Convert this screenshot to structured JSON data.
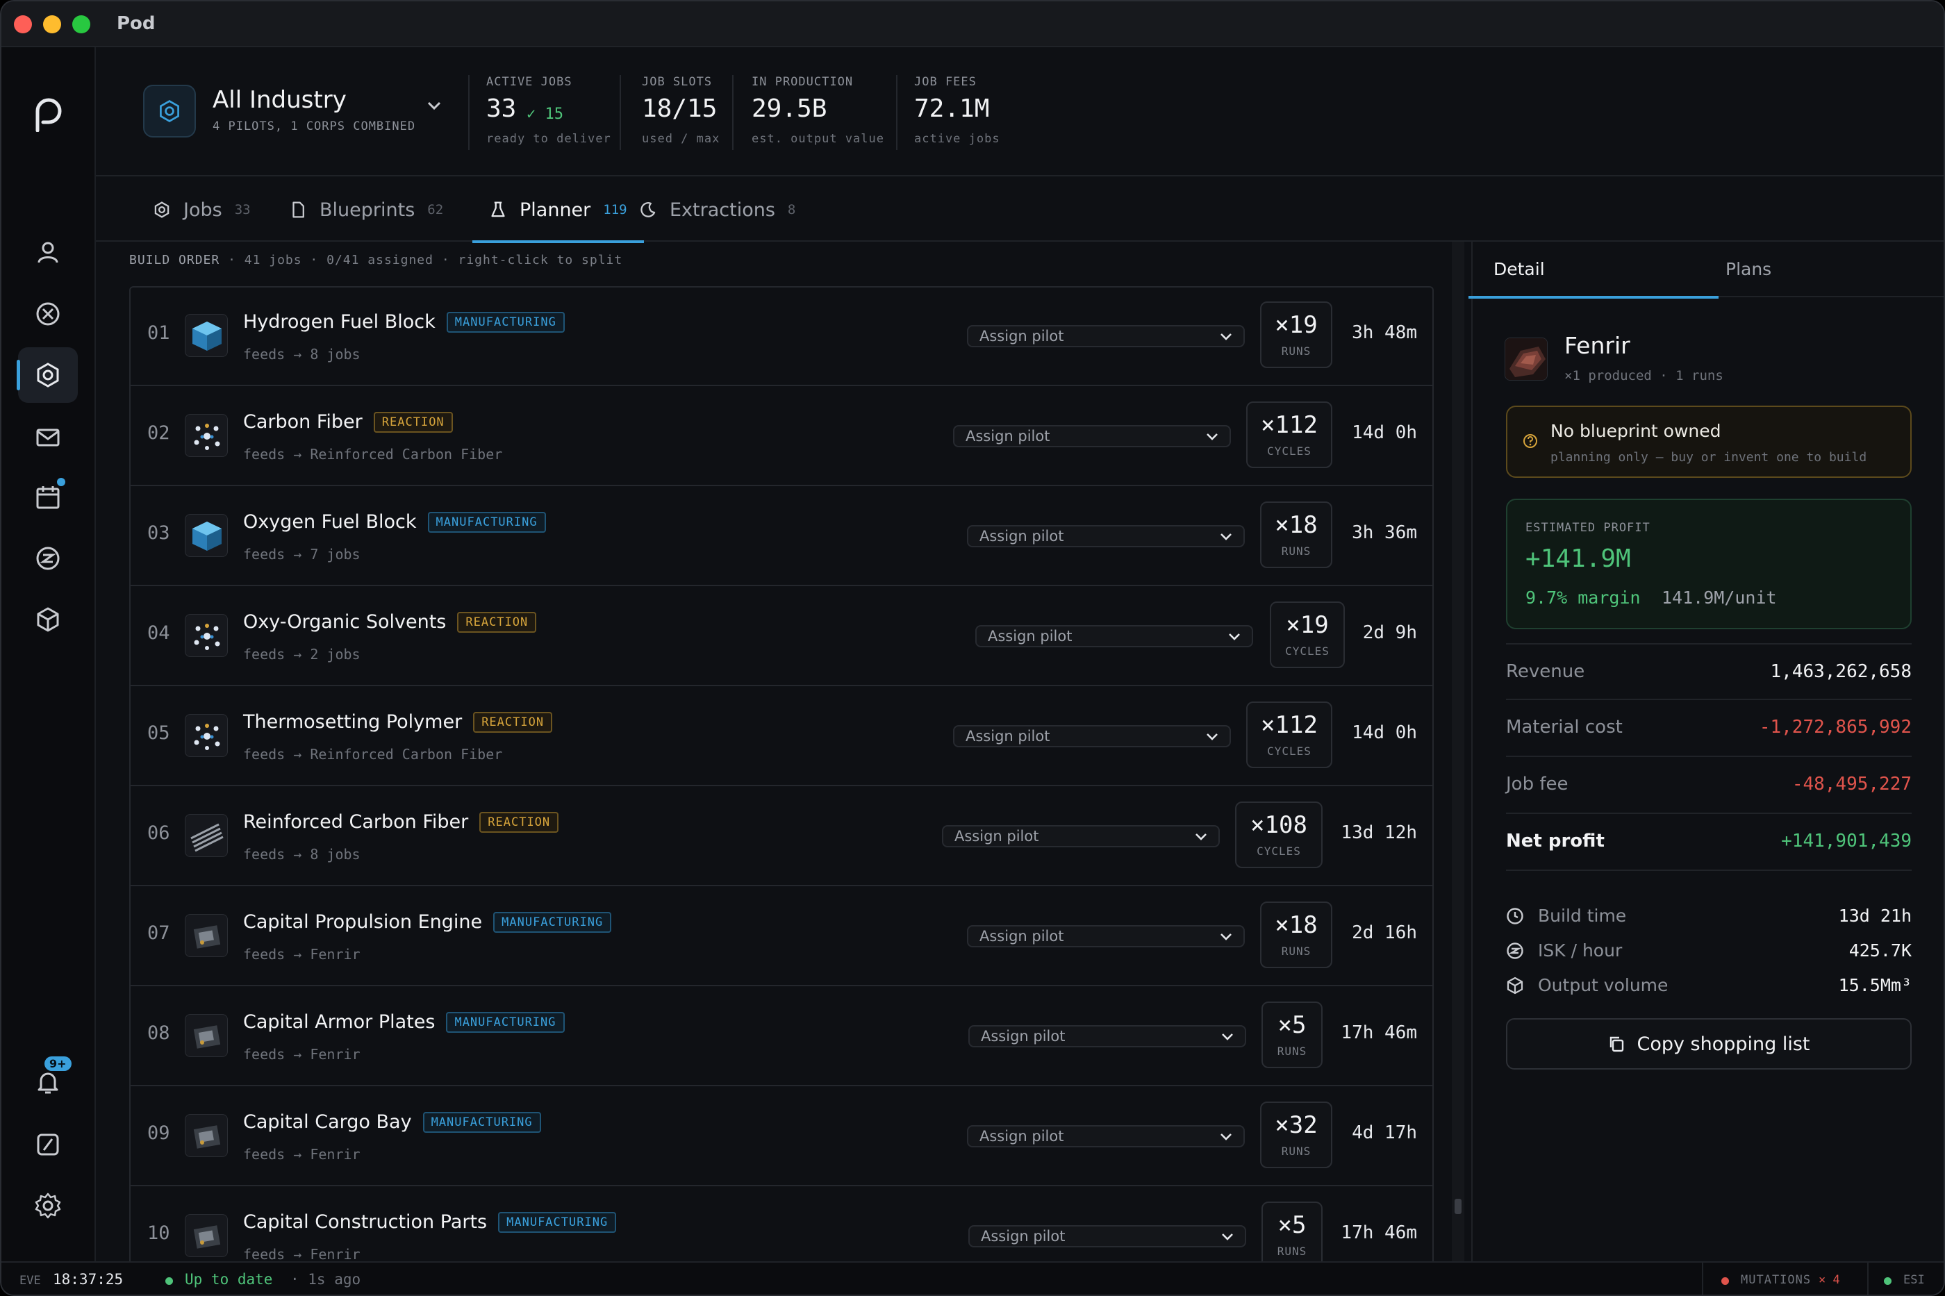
{
  "app": {
    "title": "Pod"
  },
  "header": {
    "org_name": "All Industry",
    "org_sub": "4 PILOTS, 1 CORPS COMBINED",
    "stats": [
      {
        "label": "ACTIVE JOBS",
        "value": "33",
        "extra": "✓ 15",
        "sub": "ready to deliver"
      },
      {
        "label": "JOB SLOTS",
        "value": "18/15",
        "sub": "used / max"
      },
      {
        "label": "IN PRODUCTION",
        "value": "29.5B",
        "sub": "est. output value"
      },
      {
        "label": "JOB FEES",
        "value": "72.1M",
        "sub": "active jobs"
      }
    ]
  },
  "rail": {
    "notif_badge": "9+"
  },
  "tabs": [
    {
      "label": "Jobs",
      "count": "33",
      "icon": "gear-icon"
    },
    {
      "label": "Blueprints",
      "count": "62",
      "icon": "document-icon"
    },
    {
      "label": "Planner",
      "count": "119",
      "icon": "flask-icon"
    },
    {
      "label": "Extractions",
      "count": "8",
      "icon": "moon-icon"
    }
  ],
  "build_order": {
    "title": "BUILD ORDER",
    "meta": "· 41 jobs · 0/41 assigned · right-click to split",
    "assign_placeholder": "Assign pilot",
    "rows": [
      {
        "num": "01",
        "name": "Hydrogen Fuel Block",
        "tag": "MANUFACTURING",
        "feeds": "feeds → 8 jobs",
        "runs": "×19",
        "unit": "RUNS",
        "time": "3h 48m",
        "icon": "fuel-block-icon"
      },
      {
        "num": "02",
        "name": "Carbon Fiber",
        "tag": "REACTION",
        "feeds": "feeds → Reinforced Carbon Fiber",
        "runs": "×112",
        "unit": "CYCLES",
        "time": "14d 0h",
        "icon": "molecule-icon"
      },
      {
        "num": "03",
        "name": "Oxygen Fuel Block",
        "tag": "MANUFACTURING",
        "feeds": "feeds → 7 jobs",
        "runs": "×18",
        "unit": "RUNS",
        "time": "3h 36m",
        "icon": "fuel-block-icon"
      },
      {
        "num": "04",
        "name": "Oxy-Organic Solvents",
        "tag": "REACTION",
        "feeds": "feeds → 2 jobs",
        "runs": "×19",
        "unit": "CYCLES",
        "time": "2d 9h",
        "icon": "molecule-icon"
      },
      {
        "num": "05",
        "name": "Thermosetting Polymer",
        "tag": "REACTION",
        "feeds": "feeds → Reinforced Carbon Fiber",
        "runs": "×112",
        "unit": "CYCLES",
        "time": "14d 0h",
        "icon": "molecule-icon"
      },
      {
        "num": "06",
        "name": "Reinforced Carbon Fiber",
        "tag": "REACTION",
        "feeds": "feeds → 8 jobs",
        "runs": "×108",
        "unit": "CYCLES",
        "time": "13d 12h",
        "icon": "fiber-icon"
      },
      {
        "num": "07",
        "name": "Capital Propulsion Engine",
        "tag": "MANUFACTURING",
        "feeds": "feeds → Fenrir",
        "runs": "×18",
        "unit": "RUNS",
        "time": "2d 16h",
        "icon": "component-icon"
      },
      {
        "num": "08",
        "name": "Capital Armor Plates",
        "tag": "MANUFACTURING",
        "feeds": "feeds → Fenrir",
        "runs": "×5",
        "unit": "RUNS",
        "time": "17h 46m",
        "icon": "component-icon"
      },
      {
        "num": "09",
        "name": "Capital Cargo Bay",
        "tag": "MANUFACTURING",
        "feeds": "feeds → Fenrir",
        "runs": "×32",
        "unit": "RUNS",
        "time": "4d 17h",
        "icon": "component-icon"
      },
      {
        "num": "10",
        "name": "Capital Construction Parts",
        "tag": "MANUFACTURING",
        "feeds": "feeds → Fenrir",
        "runs": "×5",
        "unit": "RUNS",
        "time": "17h 46m",
        "icon": "component-icon"
      }
    ]
  },
  "detail": {
    "tabs": [
      "Detail",
      "Plans"
    ],
    "ship_name": "Fenrir",
    "ship_sub": "×1 produced · 1 runs",
    "no_bp_title": "No blueprint owned",
    "no_bp_sub": "planning only — buy or invent one to build",
    "profit_label": "ESTIMATED PROFIT",
    "profit_value": "+141.9M",
    "profit_margin": "9.7% margin",
    "profit_unit": "141.9M/unit",
    "financials": [
      {
        "label": "Revenue",
        "value": "1,463,262,658",
        "tone": "neutral"
      },
      {
        "label": "Material cost",
        "value": "-1,272,865,992",
        "tone": "red"
      },
      {
        "label": "Job fee",
        "value": "-48,495,227",
        "tone": "red"
      },
      {
        "label": "Net profit",
        "value": "+141,901,439",
        "tone": "green"
      }
    ],
    "meta": [
      {
        "label": "Build time",
        "value": "13d 21h",
        "icon": "clock-icon"
      },
      {
        "label": "ISK / hour",
        "value": "425.7K",
        "icon": "isk-icon"
      },
      {
        "label": "Output volume",
        "value": "15.5Mm³",
        "icon": "cube-icon"
      }
    ],
    "copy_label": "Copy shopping list"
  },
  "status": {
    "eve_label": "EVE",
    "clock": "18:37:25",
    "sync": "Up to date",
    "sync_ago": "· 1s ago",
    "mutations": "MUTATIONS",
    "mutations_count": "× 4",
    "esi": "ESI",
    "colors": {
      "ok": "#4fc47a",
      "warn": "#e0544c",
      "accent": "#3aa0dc"
    }
  }
}
